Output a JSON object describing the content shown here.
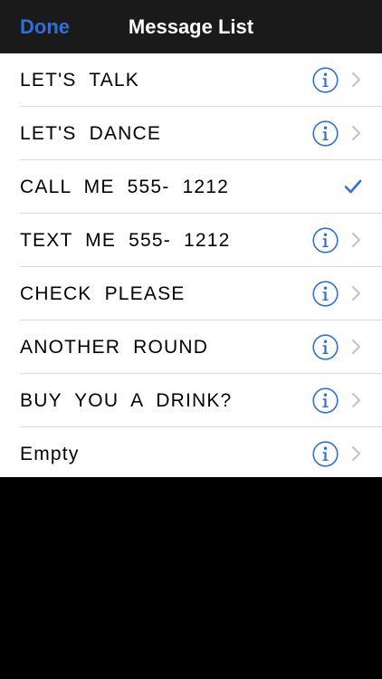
{
  "navbar": {
    "done_label": "Done",
    "title": "Message List"
  },
  "messages": [
    {
      "label": "LET'S  TALK",
      "accessory": "info-chevron"
    },
    {
      "label": "LET'S  DANCE",
      "accessory": "info-chevron"
    },
    {
      "label": "CALL  ME  555-  1212",
      "accessory": "checkmark"
    },
    {
      "label": "TEXT  ME  555-  1212",
      "accessory": "info-chevron"
    },
    {
      "label": "CHECK  PLEASE",
      "accessory": "info-chevron"
    },
    {
      "label": "ANOTHER  ROUND",
      "accessory": "info-chevron"
    },
    {
      "label": "BUY  YOU  A  DRINK?",
      "accessory": "info-chevron"
    },
    {
      "label": "Empty",
      "accessory": "info-chevron"
    }
  ],
  "icons": {
    "info": "info-circle-icon",
    "chevron": "chevron-right-icon",
    "check": "checkmark-icon"
  },
  "colors": {
    "accent": "#2e6fd9",
    "navbar_bg": "#1a1a1a",
    "list_bg": "#ffffff",
    "screen_bg": "#000000",
    "chevron": "#c4c4c7",
    "separator": "#d9d9de"
  }
}
